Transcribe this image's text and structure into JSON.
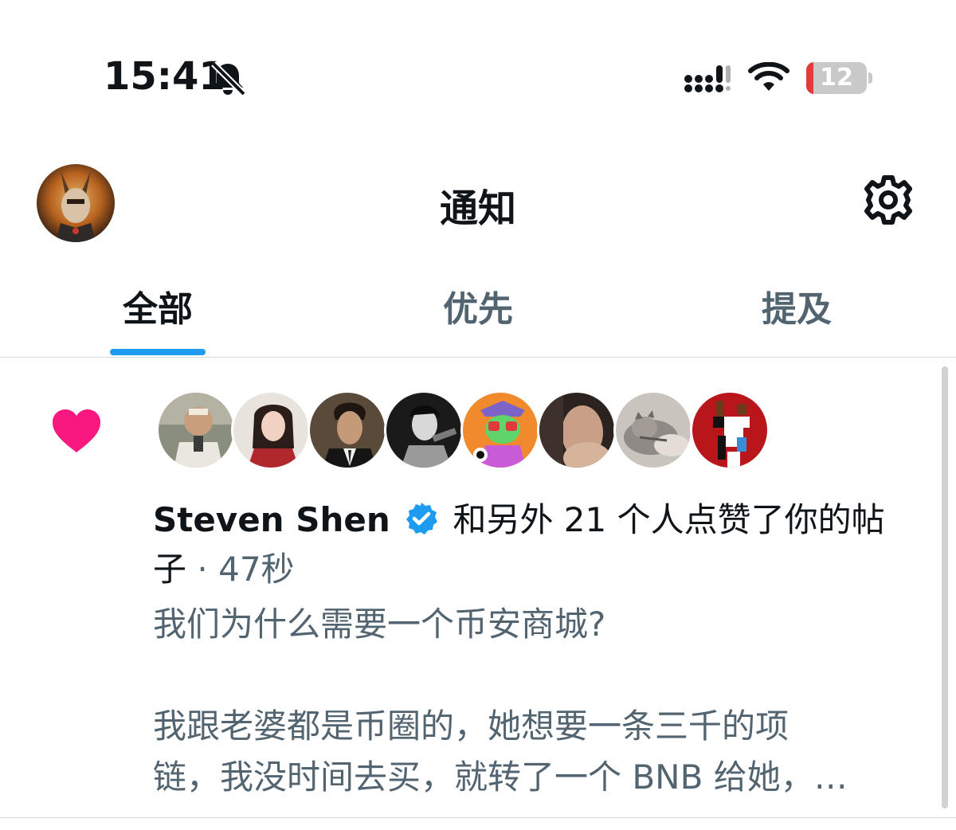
{
  "status_bar": {
    "time": "15:41",
    "battery_percent": "12",
    "battery_level": 0.12,
    "battery_color": "#e53a3a",
    "icons": [
      "bell-off-icon",
      "signal-icon",
      "wifi-icon",
      "battery-icon"
    ]
  },
  "header": {
    "title": "通知",
    "icons": [
      "avatar",
      "gear-icon"
    ]
  },
  "tabs": [
    {
      "label": "全部",
      "active": true
    },
    {
      "label": "优先",
      "active": false
    },
    {
      "label": "提及",
      "active": false
    }
  ],
  "colors": {
    "accent": "#1d9bf0",
    "like": "#f91880",
    "text_primary": "#0f1419",
    "text_secondary": "#536471"
  },
  "notification": {
    "type_icon": "heart-icon",
    "liker_count_shown": 8,
    "name": "Steven Shen",
    "verified": true,
    "action": "和另外 21 个人点赞了你的帖子",
    "separator": "·",
    "time": "47秒",
    "post_lines": [
      "我们为什么需要一个币安商城?",
      "",
      "我跟老婆都是币圈的，她想要一条三千的项",
      "链，我没时间去买，就转了一个 BNB 给她，…"
    ]
  }
}
